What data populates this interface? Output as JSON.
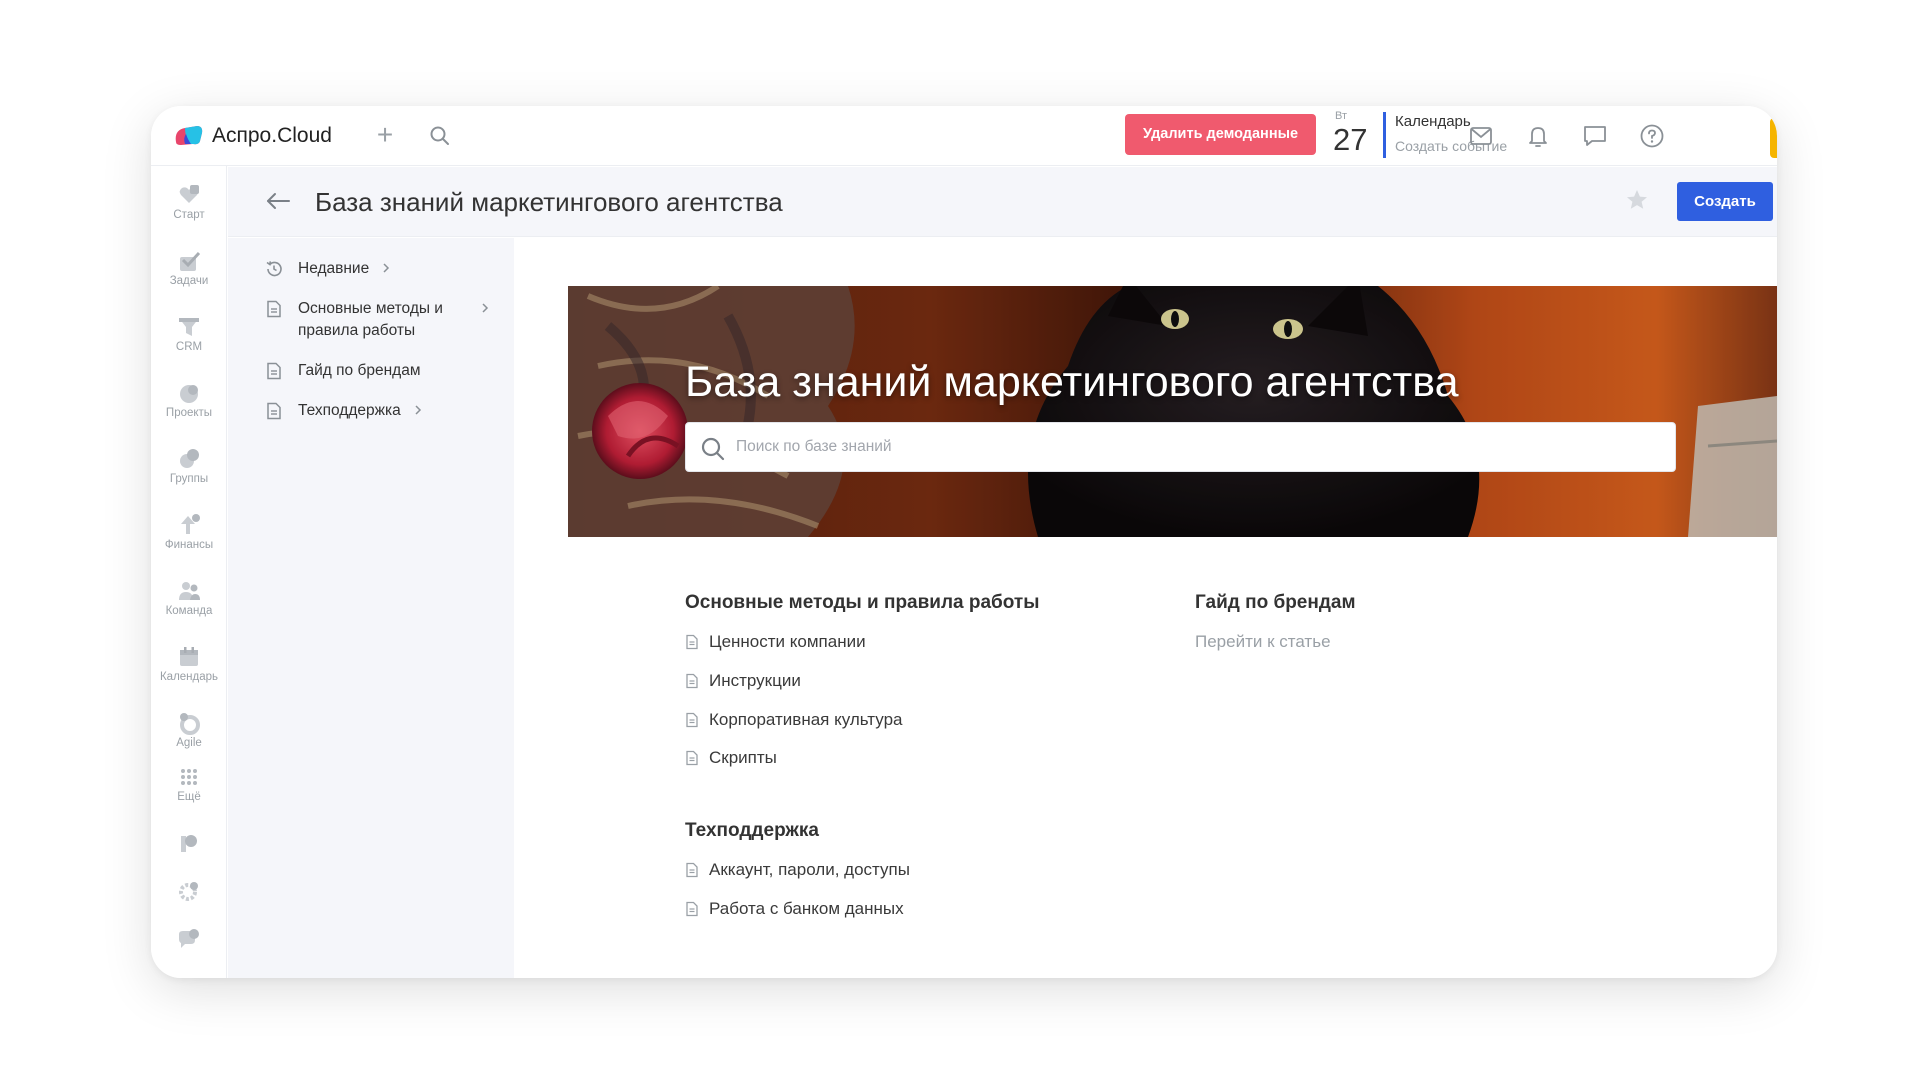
{
  "app": {
    "brand": "Аспро.Cloud"
  },
  "header": {
    "demo_button": "Удалить демоданные",
    "date": {
      "weekday": "Вт",
      "day": "27"
    },
    "calendar": {
      "title": "Календарь",
      "subtitle": "Создать событие"
    },
    "icons": [
      "plus-icon",
      "search-icon",
      "mail-icon",
      "bell-icon",
      "chat-icon",
      "help-icon"
    ]
  },
  "rail": {
    "items": [
      {
        "label": "Старт",
        "icon": "heart-icon"
      },
      {
        "label": "Задачи",
        "icon": "check-icon"
      },
      {
        "label": "CRM",
        "icon": "funnel-icon"
      },
      {
        "label": "Проекты",
        "icon": "projects-icon"
      },
      {
        "label": "Группы",
        "icon": "groups-icon"
      },
      {
        "label": "Финансы",
        "icon": "finance-icon"
      },
      {
        "label": "Команда",
        "icon": "team-icon"
      },
      {
        "label": "Календарь",
        "icon": "calendar-icon"
      },
      {
        "label": "Agile",
        "icon": "agile-icon"
      },
      {
        "label": "Ещё",
        "icon": "grid-icon"
      }
    ],
    "bottom_icons": [
      "knowledge-icon",
      "settings-icon",
      "support-chat-icon"
    ]
  },
  "page": {
    "title": "База знаний маркетингового агентства",
    "create_button": "Создать"
  },
  "tree": {
    "items": [
      {
        "label": "Недавние",
        "icon": "clock-icon",
        "has_children": true
      },
      {
        "label": "Основные методы и правила работы",
        "icon": "document-icon",
        "has_children": true
      },
      {
        "label": "Гайд по брендам",
        "icon": "document-icon",
        "has_children": false
      },
      {
        "label": "Техподдержка",
        "icon": "document-icon",
        "has_children": true
      }
    ]
  },
  "banner": {
    "title": "База знаний маркетингового агентства",
    "search_placeholder": "Поиск по базе знаний"
  },
  "sections": [
    {
      "title": "Основные методы и правила работы",
      "articles": [
        "Ценности компании",
        "Инструкции",
        "Корпоративная культура",
        "Скрипты"
      ]
    },
    {
      "title": "Гайд по брендам",
      "link": "Перейти к статье"
    },
    {
      "title": "Техподдержка",
      "articles": [
        "Аккаунт, пароли, доступы",
        "Работа с банком данных"
      ]
    }
  ],
  "colors": {
    "accent": "#2f5fe0",
    "danger": "#f05a6e",
    "highlight": "#f5b400",
    "panel_bg": "#f5f6fa"
  }
}
